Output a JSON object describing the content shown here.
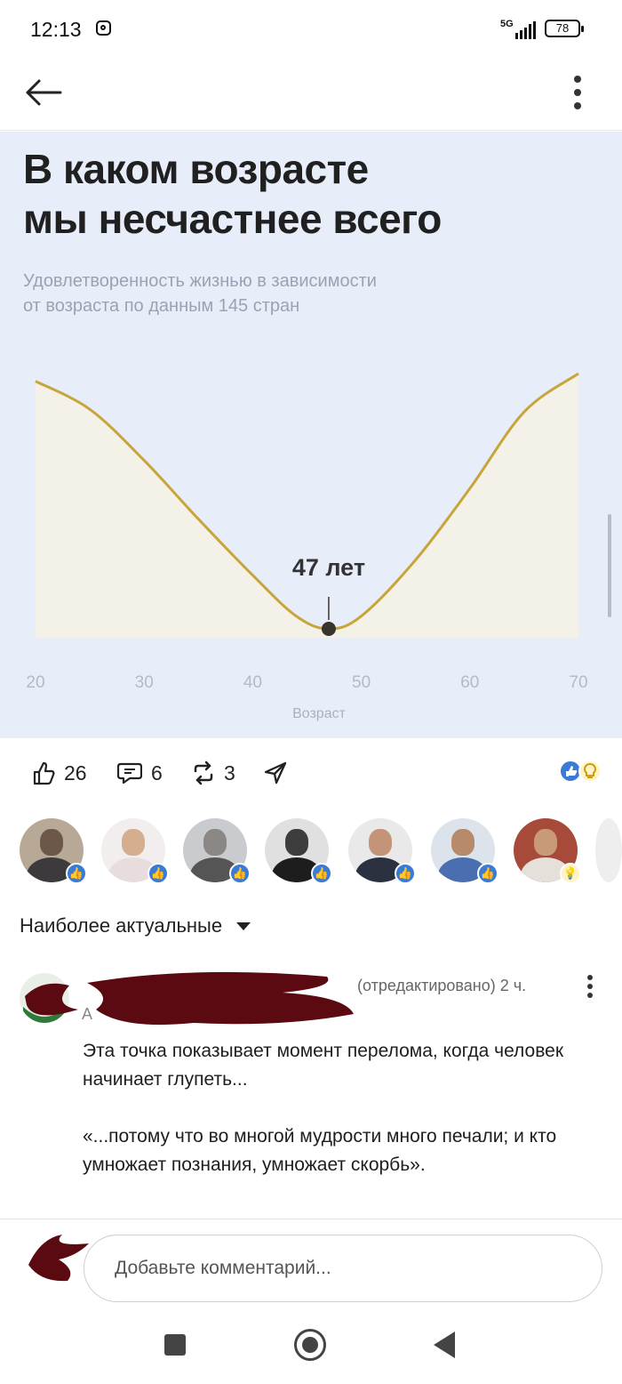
{
  "status_bar": {
    "time": "12:13",
    "network": "5G",
    "battery": "78"
  },
  "topbar": {
    "back_icon": "arrow-left-icon",
    "more_icon": "more-vertical-icon"
  },
  "post_image": {
    "title_line1": "В каком возрасте",
    "title_line2": "мы несчастнее всего",
    "subtitle_line1": "Удовлетворенность жизнью в зависимости",
    "subtitle_line2": "от возраста по данным 145 стран",
    "annotation": "47 лет",
    "chart_data": {
      "type": "area",
      "title": "В каком возрасте мы несчастнее всего",
      "subtitle": "Удовлетворенность жизнью в зависимости от возраста по данным 145 стран",
      "xlabel": "Возраст",
      "ylabel": "",
      "x_ticks": [
        "20",
        "30",
        "40",
        "50",
        "60",
        "70"
      ],
      "xlim": [
        20,
        70
      ],
      "ylim": [
        0,
        1
      ],
      "points": [
        {
          "x": 20,
          "y": 0.97
        },
        {
          "x": 25,
          "y": 0.86
        },
        {
          "x": 30,
          "y": 0.66
        },
        {
          "x": 35,
          "y": 0.43
        },
        {
          "x": 40,
          "y": 0.21
        },
        {
          "x": 44,
          "y": 0.05
        },
        {
          "x": 47,
          "y": 0.0
        },
        {
          "x": 50,
          "y": 0.05
        },
        {
          "x": 55,
          "y": 0.27
        },
        {
          "x": 60,
          "y": 0.55
        },
        {
          "x": 65,
          "y": 0.85
        },
        {
          "x": 70,
          "y": 1.0
        }
      ],
      "annotation": {
        "x": 47,
        "label": "47 лет"
      },
      "line_color": "#c8a53a",
      "marker_color": "#3a352a",
      "fill_color": "#f4f1e8",
      "grid": false
    }
  },
  "actions": {
    "likes": "26",
    "comments": "6",
    "reposts": "3",
    "like_icon": "thumbs-up-icon",
    "comment_icon": "comment-bubble-icon",
    "repost_icon": "repost-icon",
    "send_icon": "send-icon"
  },
  "reactors": [
    {
      "reaction": "like"
    },
    {
      "reaction": "like"
    },
    {
      "reaction": "like"
    },
    {
      "reaction": "like"
    },
    {
      "reaction": "like"
    },
    {
      "reaction": "like"
    },
    {
      "reaction": "insightful"
    }
  ],
  "sort": {
    "label": "Наиболее актуальные"
  },
  "comment": {
    "meta": "(отредактировано) 2 ч.",
    "author_sub": "A",
    "line1": "Эта точка показывает момент перелома, когда человек начинает глупеть...",
    "line2": "«...потому что во многой мудрости много печали; и кто умножает познания, умножает скорбь»."
  },
  "compose": {
    "placeholder": "Добавьте комментарий..."
  },
  "colors": {
    "accent": "#3a7bd5",
    "redaction": "#5a0a10",
    "chart_bg": "#e8eef9"
  }
}
